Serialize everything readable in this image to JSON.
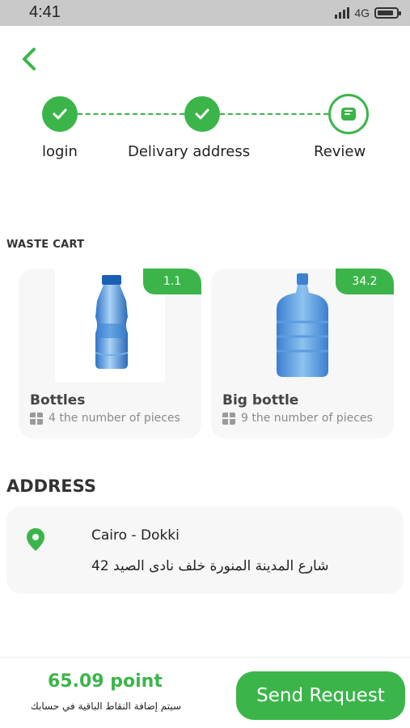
{
  "status_bar": {
    "time": "4:41",
    "network": "4G",
    "battery_level": 0.85
  },
  "header": {
    "back_icon": "chevron-left-icon"
  },
  "steps": [
    {
      "label": "login",
      "state": "done",
      "icon": "check-icon"
    },
    {
      "label": "Delivary address",
      "state": "done",
      "icon": "check-icon"
    },
    {
      "label": "Review",
      "state": "current",
      "icon": "review-icon"
    }
  ],
  "waste_cart": {
    "title": "WASTE CART",
    "items": [
      {
        "name": "Bottles",
        "badge": "1.1",
        "pieces": "4 the number of pieces",
        "image": "small-water-bottle"
      },
      {
        "name": "Big bottle",
        "badge": "34.2",
        "pieces": "9 the number of pieces",
        "image": "large-water-jug"
      }
    ]
  },
  "address": {
    "title": "ADDRESS",
    "city": "Cairo - Dokki",
    "street": "شارع المدينة المنورة خلف نادى الصيد 42",
    "icon": "location-pin-icon"
  },
  "footer": {
    "points": "65.09  point",
    "note": "سيتم إضافة النقاط الباقية في حسابك",
    "send_label": "Send Request"
  },
  "colors": {
    "accent": "#3bb54a",
    "card_bg": "#f7f7f7"
  }
}
